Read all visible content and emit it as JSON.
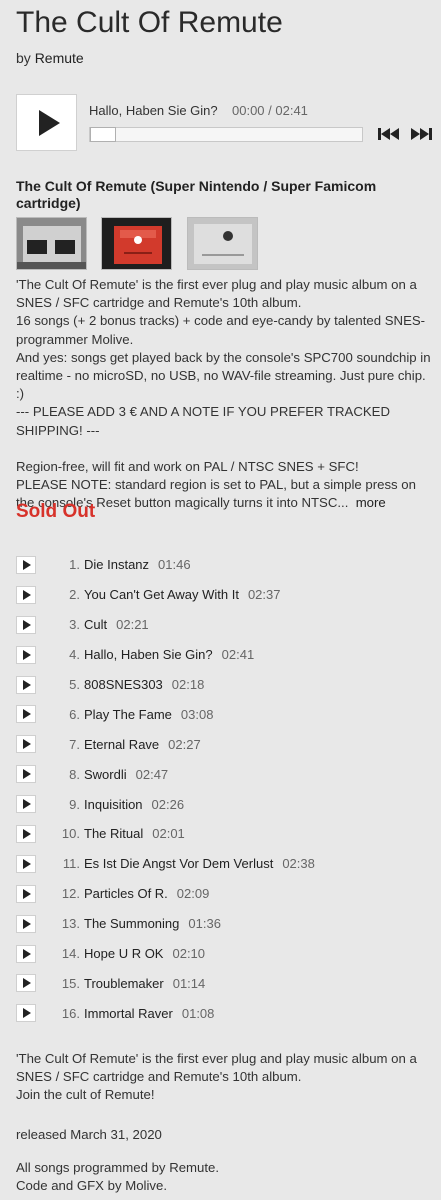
{
  "album": {
    "title": "The Cult Of Remute",
    "by_prefix": "by",
    "artist": "Remute"
  },
  "player": {
    "track_title": "Hallo, Haben Sie Gin?",
    "time": "00:00 / 02:41",
    "progress": 0
  },
  "package": {
    "title": "The Cult Of Remute (Super Nintendo / Super Famicom cartridge)",
    "description_lines": [
      "'The Cult Of Remute' is the first ever plug and play music album on a SNES / SFC cartridge and Remute's 10th album.",
      "16 songs (+ 2 bonus tracks) + code and eye-candy by talented SNES-programmer Molive.",
      "And yes: songs get played back by the console's SPC700 soundchip in realtime - no microSD, no USB, no WAV-file streaming. Just pure chip. :)",
      "--- PLEASE ADD 3 € AND A NOTE IF YOU PREFER TRACKED SHIPPING! ---",
      "",
      "Region-free, will fit and work on PAL / NTSC SNES + SFC!",
      "PLEASE NOTE: standard region is set to PAL, but a simple press on the console's Reset button magically turns it into NTSC..."
    ],
    "more_label": "more",
    "status": "Sold Out"
  },
  "tracks": [
    {
      "num": "1.",
      "name": "Die Instanz",
      "duration": "01:46"
    },
    {
      "num": "2.",
      "name": "You Can't Get Away With It",
      "duration": "02:37"
    },
    {
      "num": "3.",
      "name": "Cult",
      "duration": "02:21"
    },
    {
      "num": "4.",
      "name": "Hallo, Haben Sie Gin?",
      "duration": "02:41"
    },
    {
      "num": "5.",
      "name": "808SNES303",
      "duration": "02:18"
    },
    {
      "num": "6.",
      "name": "Play The Fame",
      "duration": "03:08"
    },
    {
      "num": "7.",
      "name": "Eternal Rave",
      "duration": "02:27"
    },
    {
      "num": "8.",
      "name": "Swordli",
      "duration": "02:47"
    },
    {
      "num": "9.",
      "name": "Inquisition",
      "duration": "02:26"
    },
    {
      "num": "10.",
      "name": "The Ritual",
      "duration": "02:01"
    },
    {
      "num": "11.",
      "name": "Es Ist Die Angst Vor Dem Verlust",
      "duration": "02:38"
    },
    {
      "num": "12.",
      "name": "Particles Of R.",
      "duration": "02:09"
    },
    {
      "num": "13.",
      "name": "The Summoning",
      "duration": "01:36"
    },
    {
      "num": "14.",
      "name": "Hope U R OK",
      "duration": "02:10"
    },
    {
      "num": "15.",
      "name": "Troublemaker",
      "duration": "01:14"
    },
    {
      "num": "16.",
      "name": "Immortal Raver",
      "duration": "01:08"
    }
  ],
  "footer": {
    "about_lines": [
      "'The Cult Of Remute' is the first ever plug and play music album on a SNES / SFC cartridge and Remute's 10th album.",
      "Join the cult of Remute!"
    ],
    "released": "released March 31, 2020",
    "credits_lines": [
      "All songs programmed by Remute.",
      "Code and GFX by Molive."
    ]
  },
  "colors": {
    "background": "#e8e8e8",
    "sold_out": "#d7322a",
    "text": "#333333"
  }
}
